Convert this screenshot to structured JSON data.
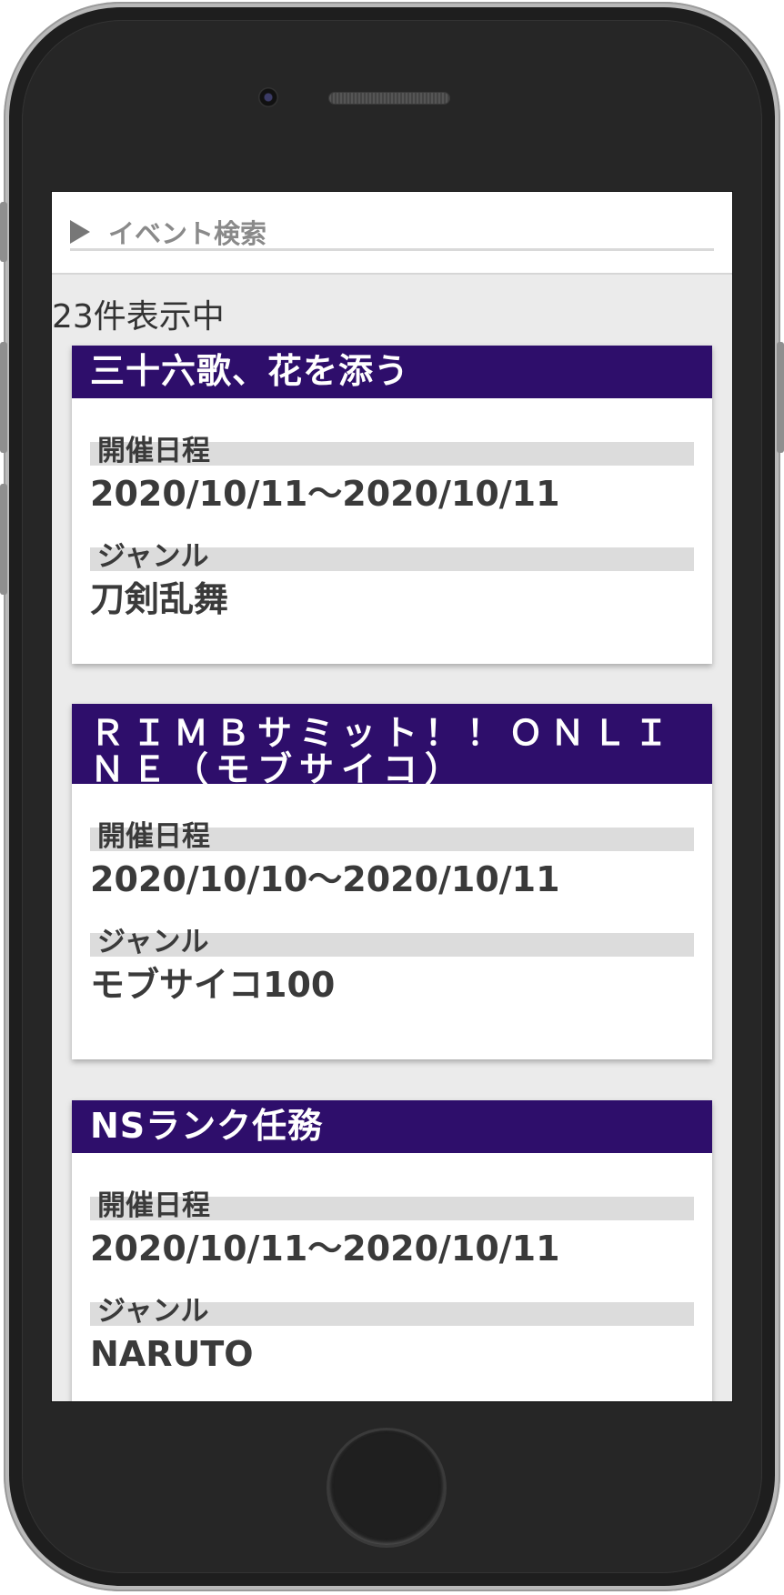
{
  "search": {
    "label": "イベント検索"
  },
  "results": {
    "count_text": "23件表示中"
  },
  "labels": {
    "date": "開催日程",
    "genre": "ジャンル"
  },
  "events": [
    {
      "title": "三十六歌、花を添う",
      "date": "2020/10/11〜2020/10/11",
      "genre": "刀剣乱舞"
    },
    {
      "title": "ＲＩＭＢサミット！！ＯＮＬＩＮＥ（モブサイコ）",
      "date": "2020/10/10〜2020/10/11",
      "genre": "モブサイコ100"
    },
    {
      "title": "NSランク任務",
      "date": "2020/10/11〜2020/10/11",
      "genre": "NARUTO"
    }
  ]
}
